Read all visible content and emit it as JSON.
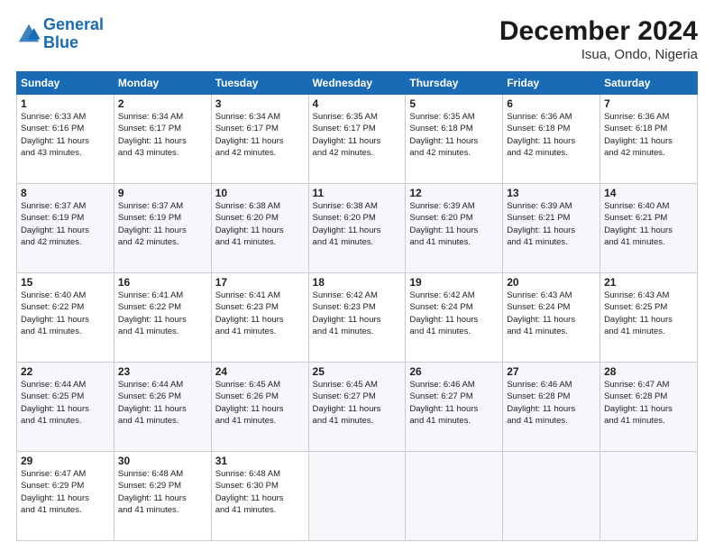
{
  "logo": {
    "line1": "General",
    "line2": "Blue"
  },
  "title": "December 2024",
  "subtitle": "Isua, Ondo, Nigeria",
  "header_days": [
    "Sunday",
    "Monday",
    "Tuesday",
    "Wednesday",
    "Thursday",
    "Friday",
    "Saturday"
  ],
  "weeks": [
    [
      {
        "day": "1",
        "info": "Sunrise: 6:33 AM\nSunset: 6:16 PM\nDaylight: 11 hours\nand 43 minutes."
      },
      {
        "day": "2",
        "info": "Sunrise: 6:34 AM\nSunset: 6:17 PM\nDaylight: 11 hours\nand 43 minutes."
      },
      {
        "day": "3",
        "info": "Sunrise: 6:34 AM\nSunset: 6:17 PM\nDaylight: 11 hours\nand 42 minutes."
      },
      {
        "day": "4",
        "info": "Sunrise: 6:35 AM\nSunset: 6:17 PM\nDaylight: 11 hours\nand 42 minutes."
      },
      {
        "day": "5",
        "info": "Sunrise: 6:35 AM\nSunset: 6:18 PM\nDaylight: 11 hours\nand 42 minutes."
      },
      {
        "day": "6",
        "info": "Sunrise: 6:36 AM\nSunset: 6:18 PM\nDaylight: 11 hours\nand 42 minutes."
      },
      {
        "day": "7",
        "info": "Sunrise: 6:36 AM\nSunset: 6:18 PM\nDaylight: 11 hours\nand 42 minutes."
      }
    ],
    [
      {
        "day": "8",
        "info": "Sunrise: 6:37 AM\nSunset: 6:19 PM\nDaylight: 11 hours\nand 42 minutes."
      },
      {
        "day": "9",
        "info": "Sunrise: 6:37 AM\nSunset: 6:19 PM\nDaylight: 11 hours\nand 42 minutes."
      },
      {
        "day": "10",
        "info": "Sunrise: 6:38 AM\nSunset: 6:20 PM\nDaylight: 11 hours\nand 41 minutes."
      },
      {
        "day": "11",
        "info": "Sunrise: 6:38 AM\nSunset: 6:20 PM\nDaylight: 11 hours\nand 41 minutes."
      },
      {
        "day": "12",
        "info": "Sunrise: 6:39 AM\nSunset: 6:20 PM\nDaylight: 11 hours\nand 41 minutes."
      },
      {
        "day": "13",
        "info": "Sunrise: 6:39 AM\nSunset: 6:21 PM\nDaylight: 11 hours\nand 41 minutes."
      },
      {
        "day": "14",
        "info": "Sunrise: 6:40 AM\nSunset: 6:21 PM\nDaylight: 11 hours\nand 41 minutes."
      }
    ],
    [
      {
        "day": "15",
        "info": "Sunrise: 6:40 AM\nSunset: 6:22 PM\nDaylight: 11 hours\nand 41 minutes."
      },
      {
        "day": "16",
        "info": "Sunrise: 6:41 AM\nSunset: 6:22 PM\nDaylight: 11 hours\nand 41 minutes."
      },
      {
        "day": "17",
        "info": "Sunrise: 6:41 AM\nSunset: 6:23 PM\nDaylight: 11 hours\nand 41 minutes."
      },
      {
        "day": "18",
        "info": "Sunrise: 6:42 AM\nSunset: 6:23 PM\nDaylight: 11 hours\nand 41 minutes."
      },
      {
        "day": "19",
        "info": "Sunrise: 6:42 AM\nSunset: 6:24 PM\nDaylight: 11 hours\nand 41 minutes."
      },
      {
        "day": "20",
        "info": "Sunrise: 6:43 AM\nSunset: 6:24 PM\nDaylight: 11 hours\nand 41 minutes."
      },
      {
        "day": "21",
        "info": "Sunrise: 6:43 AM\nSunset: 6:25 PM\nDaylight: 11 hours\nand 41 minutes."
      }
    ],
    [
      {
        "day": "22",
        "info": "Sunrise: 6:44 AM\nSunset: 6:25 PM\nDaylight: 11 hours\nand 41 minutes."
      },
      {
        "day": "23",
        "info": "Sunrise: 6:44 AM\nSunset: 6:26 PM\nDaylight: 11 hours\nand 41 minutes."
      },
      {
        "day": "24",
        "info": "Sunrise: 6:45 AM\nSunset: 6:26 PM\nDaylight: 11 hours\nand 41 minutes."
      },
      {
        "day": "25",
        "info": "Sunrise: 6:45 AM\nSunset: 6:27 PM\nDaylight: 11 hours\nand 41 minutes."
      },
      {
        "day": "26",
        "info": "Sunrise: 6:46 AM\nSunset: 6:27 PM\nDaylight: 11 hours\nand 41 minutes."
      },
      {
        "day": "27",
        "info": "Sunrise: 6:46 AM\nSunset: 6:28 PM\nDaylight: 11 hours\nand 41 minutes."
      },
      {
        "day": "28",
        "info": "Sunrise: 6:47 AM\nSunset: 6:28 PM\nDaylight: 11 hours\nand 41 minutes."
      }
    ],
    [
      {
        "day": "29",
        "info": "Sunrise: 6:47 AM\nSunset: 6:29 PM\nDaylight: 11 hours\nand 41 minutes."
      },
      {
        "day": "30",
        "info": "Sunrise: 6:48 AM\nSunset: 6:29 PM\nDaylight: 11 hours\nand 41 minutes."
      },
      {
        "day": "31",
        "info": "Sunrise: 6:48 AM\nSunset: 6:30 PM\nDaylight: 11 hours\nand 41 minutes."
      },
      {
        "day": "",
        "info": ""
      },
      {
        "day": "",
        "info": ""
      },
      {
        "day": "",
        "info": ""
      },
      {
        "day": "",
        "info": ""
      }
    ]
  ]
}
